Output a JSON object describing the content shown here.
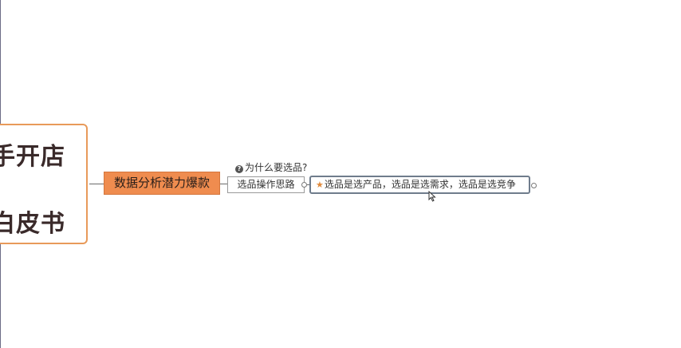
{
  "root": {
    "line1": "手开店",
    "line2": "白皮书"
  },
  "main_topic": {
    "label": "数据分析潜力爆款"
  },
  "sub_topic": {
    "label": "选品操作思路",
    "note": "为什么要选品?",
    "note_icon": "?"
  },
  "leaf_topic": {
    "label": "选品是选产品，选品是选需求，选品是选竞争",
    "icon": "★"
  },
  "colors": {
    "root_border": "#e89a5a",
    "main_topic_fill": "#ef8c4f",
    "leaf_border": "#6f7c8c",
    "star": "#e08a3c"
  }
}
